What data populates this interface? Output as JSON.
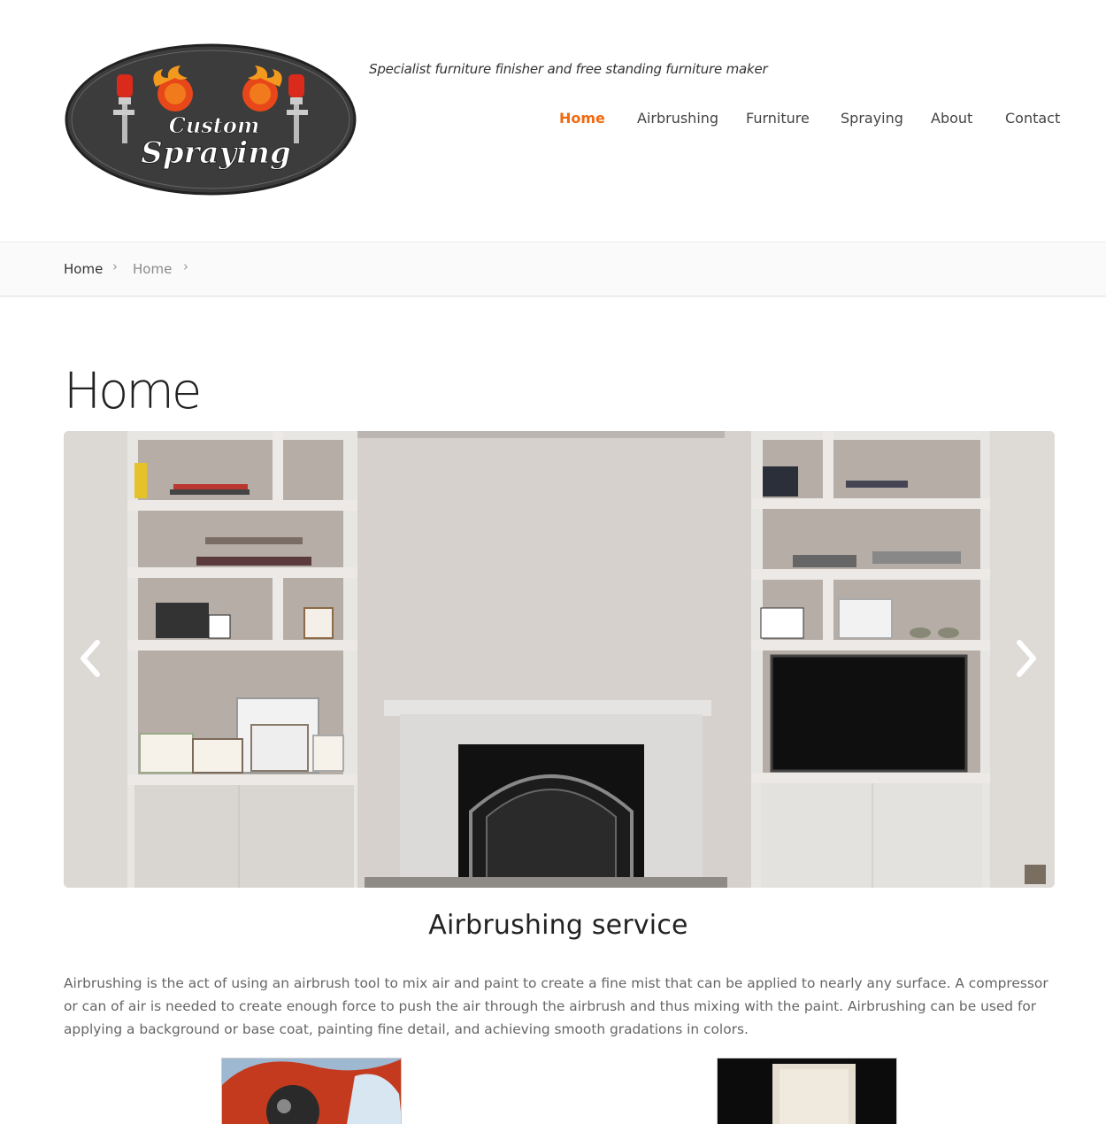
{
  "header": {
    "logo_line1": "Custom",
    "logo_line2": "Spraying",
    "tagline": "Specialist furniture finisher and free standing furniture maker"
  },
  "nav": {
    "items": [
      {
        "label": "Home",
        "active": true
      },
      {
        "label": "Airbrushing",
        "active": false
      },
      {
        "label": "Furniture",
        "active": false
      },
      {
        "label": "Spraying",
        "active": false
      },
      {
        "label": "About",
        "active": false
      },
      {
        "label": "Contact",
        "active": false
      }
    ]
  },
  "breadcrumb": {
    "items": [
      "Home",
      "Home"
    ],
    "separator": "›"
  },
  "page": {
    "title": "Home"
  },
  "slider": {
    "prev_icon": "chevron-left-icon",
    "next_icon": "chevron-right-icon"
  },
  "section": {
    "title": "Airbrushing service",
    "body": "Airbrushing is the act of using an airbrush tool to mix air and paint to create a fine mist that can be applied to nearly any surface. A compressor or can of air is needed to create enough force to push the air through the airbrush and thus mixing with the paint. Airbrushing can be used for applying a background or base coat, painting fine detail, and achieving smooth gradations in colors."
  },
  "colors": {
    "accent": "#f26a10",
    "text": "#333333",
    "muted": "#666666",
    "logo_bg": "#3d3d3d"
  }
}
